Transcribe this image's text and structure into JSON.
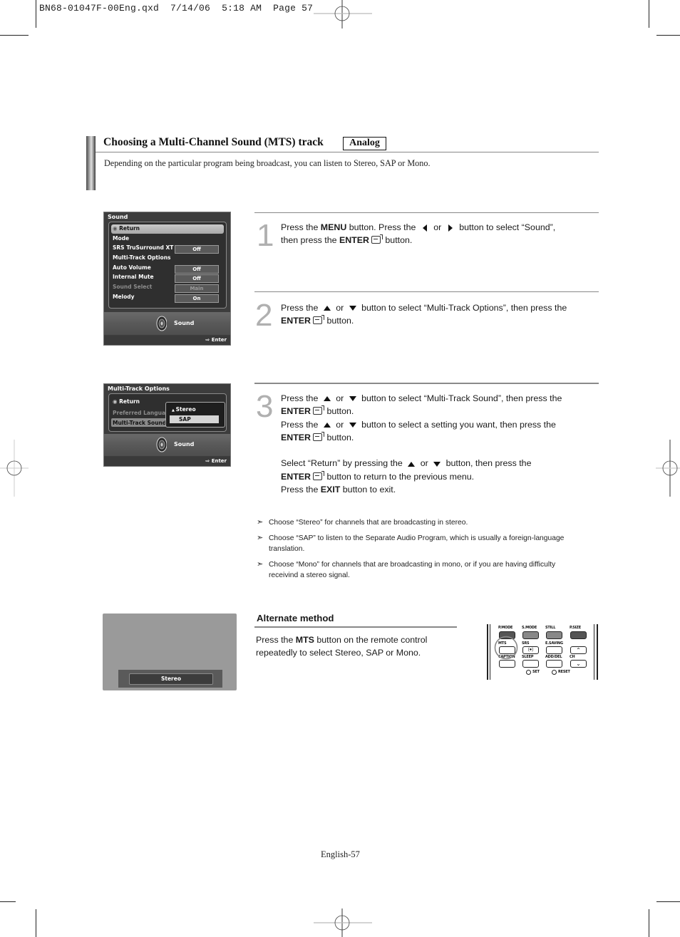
{
  "print_slug": {
    "file": "BN68-01047F-00Eng.qxd",
    "date": "7/14/06",
    "time": "5:18 AM",
    "page_label": "Page",
    "page_number": "57"
  },
  "header": {
    "title": "Choosing a Multi-Channel Sound (MTS) track",
    "badge": "Analog",
    "intro": "Depending on the particular program being broadcast, you can listen to Stereo, SAP or Mono."
  },
  "osd_sound_menu": {
    "title": "Sound",
    "rows": [
      {
        "label": "Return",
        "value": null,
        "highlighted": true,
        "dimmed": false
      },
      {
        "label": "Mode",
        "value": null,
        "highlighted": false,
        "dimmed": false
      },
      {
        "label": "SRS TruSurround XT",
        "value": "Off",
        "highlighted": false,
        "dimmed": false
      },
      {
        "label": "Multi-Track Options",
        "value": null,
        "highlighted": false,
        "dimmed": false
      },
      {
        "label": "Auto Volume",
        "value": "Off",
        "highlighted": false,
        "dimmed": false
      },
      {
        "label": "Internal Mute",
        "value": "Off",
        "highlighted": false,
        "dimmed": false
      },
      {
        "label": "Sound Select",
        "value": "Main",
        "highlighted": false,
        "dimmed": true
      },
      {
        "label": "Melody",
        "value": "On",
        "highlighted": false,
        "dimmed": false
      }
    ],
    "footer_label": "Sound",
    "enter_label": "Enter"
  },
  "osd_multitrack_menu": {
    "title": "Multi-Track Options",
    "rows": [
      {
        "label": "Return"
      },
      {
        "label": "Preferred Language"
      },
      {
        "label": "Multi-Track Sound"
      }
    ],
    "dropdown": {
      "options": [
        "Stereo",
        "SAP"
      ],
      "selected": "SAP"
    },
    "footer_label": "Sound",
    "enter_label": "Enter"
  },
  "steps": [
    {
      "number": "1",
      "lines": [
        {
          "parts": [
            [
              "t",
              "Press the "
            ],
            [
              "b",
              "MENU"
            ],
            [
              "t",
              " button. Press the "
            ],
            [
              "i",
              "left"
            ],
            [
              "t",
              " or "
            ],
            [
              "i",
              "right"
            ],
            [
              "t",
              " button to select “Sound”,"
            ]
          ]
        },
        {
          "parts": [
            [
              "t",
              "then press the "
            ],
            [
              "b",
              "ENTER"
            ],
            [
              "i",
              "enter"
            ],
            [
              "t",
              " button."
            ]
          ]
        }
      ]
    },
    {
      "number": "2",
      "lines": [
        {
          "parts": [
            [
              "t",
              "Press the "
            ],
            [
              "i",
              "up"
            ],
            [
              "t",
              " or "
            ],
            [
              "i",
              "down"
            ],
            [
              "t",
              " button to select “Multi-Track Options”, then press the"
            ]
          ]
        },
        {
          "parts": [
            [
              "b",
              "ENTER"
            ],
            [
              "i",
              "enter"
            ],
            [
              "t",
              " button."
            ]
          ]
        }
      ]
    },
    {
      "number": "3",
      "lines": [
        {
          "parts": [
            [
              "t",
              "Press the "
            ],
            [
              "i",
              "up"
            ],
            [
              "t",
              " or "
            ],
            [
              "i",
              "down"
            ],
            [
              "t",
              " button to select “Multi-Track Sound”, then press the"
            ]
          ]
        },
        {
          "parts": [
            [
              "b",
              "ENTER"
            ],
            [
              "i",
              "enter"
            ],
            [
              "t",
              " button."
            ]
          ]
        },
        {
          "parts": [
            [
              "t",
              "Press the "
            ],
            [
              "i",
              "up"
            ],
            [
              "t",
              " or "
            ],
            [
              "i",
              "down"
            ],
            [
              "t",
              " button to select a setting you want, then press the"
            ]
          ]
        },
        {
          "parts": [
            [
              "b",
              "ENTER"
            ],
            [
              "i",
              "enter"
            ],
            [
              "t",
              " button."
            ]
          ]
        },
        {
          "parts": []
        },
        {
          "parts": [
            [
              "t",
              "Select “Return” by pressing the "
            ],
            [
              "i",
              "up"
            ],
            [
              "t",
              " or "
            ],
            [
              "i",
              "down"
            ],
            [
              "t",
              " button, then press the"
            ]
          ]
        },
        {
          "parts": [
            [
              "b",
              "ENTER"
            ],
            [
              "i",
              "enter"
            ],
            [
              "t",
              " button to return to the previous menu."
            ]
          ]
        },
        {
          "parts": [
            [
              "t",
              "Press the "
            ],
            [
              "b",
              "EXIT"
            ],
            [
              "t",
              " button to exit."
            ]
          ]
        }
      ]
    }
  ],
  "notes": [
    "Choose “Stereo” for channels that are broadcasting in stereo.",
    "Choose “SAP” to listen to the Separate Audio Program, which is usually a foreign-language translation.",
    "Choose “Mono” for channels that are broadcasting in mono, or if you are having difficulty receivind a stereo signal."
  ],
  "note_marker": "➣",
  "alternate": {
    "title": "Alternate method",
    "text_parts": [
      [
        "t",
        "Press the "
      ],
      [
        "b",
        "MTS"
      ],
      [
        "t",
        " button on the remote control repeatedly to select Stereo, SAP or Mono."
      ]
    ],
    "tv_banner": "Stereo"
  },
  "remote": {
    "row1": [
      "P.MODE",
      "S.MODE",
      "STILL",
      "P.SIZE"
    ],
    "row2": [
      "MTS",
      "SRS",
      "E.SAVING",
      ""
    ],
    "row3": [
      "CAPTION",
      "SLEEP",
      "ADD/DEL",
      "CH"
    ],
    "bottom": [
      "SET",
      "RESET"
    ],
    "highlighted_button": "MTS"
  },
  "footer": {
    "page_label": "English-57"
  }
}
